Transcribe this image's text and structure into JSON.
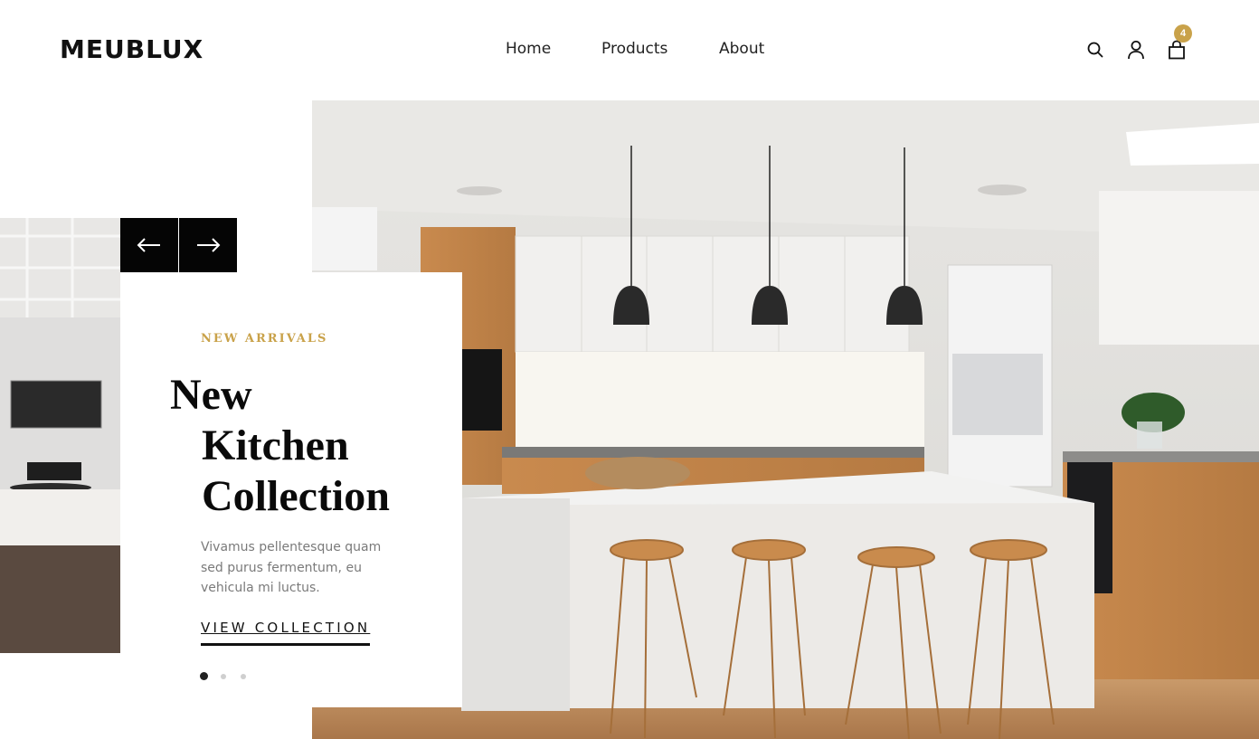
{
  "header": {
    "logo": "MEUBLUX",
    "nav": [
      {
        "label": "Home"
      },
      {
        "label": "Products"
      },
      {
        "label": "About"
      }
    ],
    "icons": [
      "search-icon",
      "user-icon",
      "cart-icon"
    ],
    "cart_count": "4",
    "accent_color": "#c9a24a"
  },
  "hero": {
    "eyebrow": "NEW ARRIVALS",
    "title_lines": [
      "New",
      "Kitchen",
      "Collection"
    ],
    "description": "Vivamus pellentesque quam sed purus fermentum, eu vehicula mi luctus.",
    "cta": "VIEW COLLECTION",
    "prev_icon": "arrow-left-icon",
    "next_icon": "arrow-right-icon",
    "slides_total": 3,
    "active_slide": 1
  }
}
